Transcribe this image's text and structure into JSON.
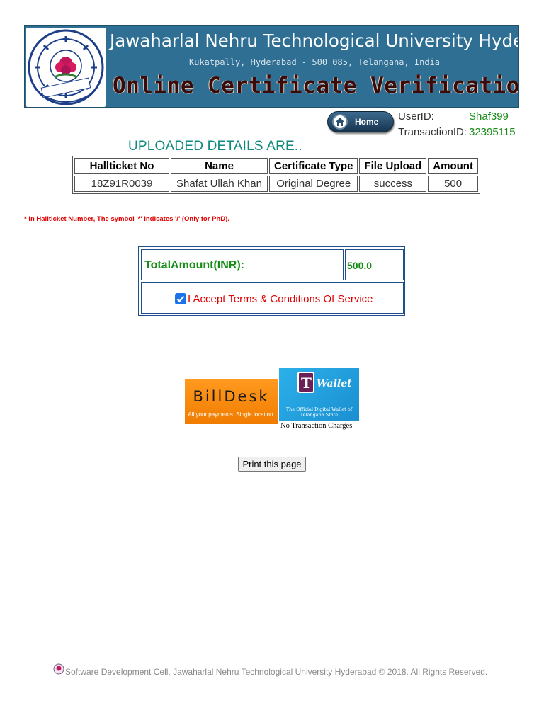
{
  "header": {
    "university_name": "Jawaharlal Nehru Technological University Hyderabad",
    "address": "Kukatpally, Hyderabad - 500 085, Telangana, India",
    "service_title": "Online Certificate Verification",
    "logo_icon": "university-seal-icon"
  },
  "nav": {
    "home_label": "Home",
    "home_icon": "home-icon"
  },
  "user": {
    "userid_label": "UserID:",
    "userid_value": "Shaf399",
    "transaction_label": "TransactionID:",
    "transaction_value": "32395115"
  },
  "uploaded": {
    "heading": "UPLOADED DETAILS ARE..",
    "columns": [
      "Hallticket No",
      "Name",
      "Certificate Type",
      "File Upload",
      "Amount"
    ],
    "rows": [
      [
        "18Z91R0039",
        "Shafat Ullah Khan",
        "Original Degree",
        "success",
        "500"
      ]
    ]
  },
  "note": "* In Hallticket Number, The symbol '*' Indicates '/' (Only for PhD).",
  "payment": {
    "total_label": "TotalAmount(INR):",
    "total_value": "500.0",
    "accept_label": "I Accept Terms & Conditions Of Service",
    "accept_checked": true
  },
  "gateways": {
    "billdesk_name": "BillDesk",
    "billdesk_tagline": "All your payments. Single location.",
    "twallet_letter": "T",
    "twallet_name": "Wallet",
    "twallet_tagline": "The Official Digital Wallet of Telangana State",
    "twallet_note": "No Transaction Charges"
  },
  "actions": {
    "print_label": "Print this page"
  },
  "footer": {
    "text": "Software Development Cell, Jawaharlal Nehru Technological University Hyderabad © 2018. All Rights Reserved."
  },
  "colors": {
    "banner": "#2e6f93",
    "green_text": "#178a17",
    "heading_teal": "#108a7e",
    "red_text": "#e00000",
    "billdesk_orange": "#f58a0b",
    "twallet_blue": "#23a3df"
  }
}
